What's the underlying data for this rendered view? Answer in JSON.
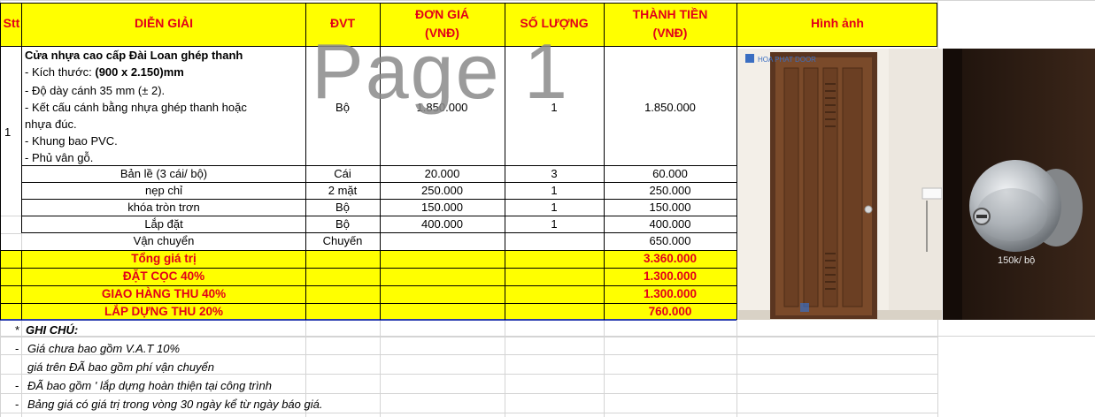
{
  "header": {
    "stt": "Stt",
    "description": "DIỄN GIẢI",
    "unit": "ĐVT",
    "unit_price_line1": "ĐƠN GIÁ",
    "unit_price_line2": "(VNĐ)",
    "quantity": "SỐ LƯỢNG",
    "total_line1": "THÀNH TIỀN",
    "total_line2": "(VNĐ)",
    "image": "Hình ảnh"
  },
  "main_item": {
    "stt": "1",
    "title": "Cửa nhựa cao cấp Đài Loan ghép thanh",
    "size_label": "- Kích thước: ",
    "size_value": "(900 x 2.150)mm",
    "thickness": "- Độ dày cánh 35 mm (± 2).",
    "structure_line1": "- Kết cấu cánh bằng nhựa ghép thanh hoặc",
    "structure_line2": "nhựa đúc.",
    "frame": "- Khung bao PVC.",
    "finish": "- Phủ vân gỗ.",
    "unit": "Bộ",
    "unit_price": "1.850.000",
    "quantity": "1",
    "total": "1.850.000"
  },
  "rows": [
    {
      "description": "Bản lề (3 cái/ bộ)",
      "unit": "Cái",
      "unit_price": "20.000",
      "quantity": "3",
      "total": "60.000"
    },
    {
      "description": "nẹp chỉ",
      "unit": "2  mặt",
      "unit_price": "250.000",
      "quantity": "1",
      "total": "250.000"
    },
    {
      "description": "khóa tròn trơn",
      "unit": "Bộ",
      "unit_price": "150.000",
      "quantity": "1",
      "total": "150.000"
    },
    {
      "description": "Lắp đặt",
      "unit": "Bộ",
      "unit_price": "400.000",
      "quantity": "1",
      "total": "400.000"
    },
    {
      "description": "Vận chuyển",
      "unit": "Chuyến",
      "unit_price": "",
      "quantity": "",
      "total": "650.000"
    }
  ],
  "summary": [
    {
      "label": "Tổng giá trị",
      "value": "3.360.000"
    },
    {
      "label": "ĐẶT CỌC 40%",
      "value": "1.300.000"
    },
    {
      "label": "GIAO HÀNG THU 40%",
      "value": "1.300.000"
    },
    {
      "label": "LẮP DỰNG THU 20%",
      "value": "760.000"
    }
  ],
  "notes": {
    "star": "*",
    "title": "GHI CHÚ:",
    "dash": "-",
    "lines": [
      "Giá chưa bao gồm V.A.T 10%",
      "giá trên ĐÃ bao gồm phí vận chuyển",
      "ĐÃ bao gồm ' lắp dựng hoàn thiện tại công trình",
      "Bảng giá có giá trị trong vòng 30 ngày kể từ ngày báo giá."
    ]
  },
  "watermark": "Page 1",
  "image_caption": "150k/ bộ",
  "colors": {
    "header_bg": "#ffff00",
    "header_text": "#e2001a",
    "summary_bg": "#ffff00",
    "door": "#7a4a2a",
    "knob": "#c4c8cc"
  },
  "icons": [
    "door-photo-icon",
    "door-knob-photo-icon",
    "brand-logo-icon"
  ]
}
